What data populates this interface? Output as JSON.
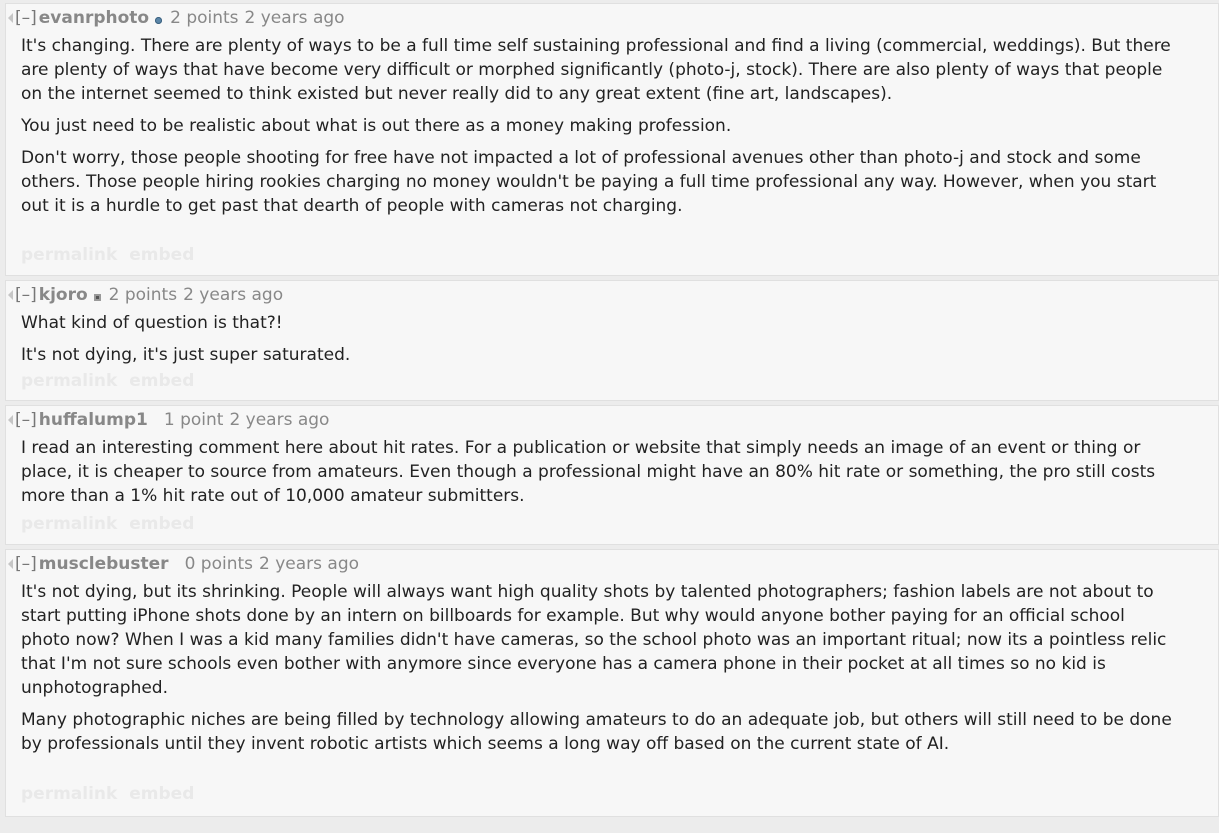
{
  "comments": [
    {
      "collapse": "[–]",
      "author": "evanrphoto",
      "flair": "globe-icon",
      "score": "2 points",
      "time": "2 years ago",
      "paragraphs": [
        "It's changing. There are plenty of ways to be a full time self sustaining professional and find a living (commercial, weddings). But there are plenty of ways that have become very difficult or morphed significantly (photo-j, stock). There are also plenty of ways that people on the internet seemed to think existed but never really did to any great extent (fine art, landscapes).",
        "You just need to be realistic about what is out there as a money making profession.",
        "Don't worry, those people shooting for free have not impacted a lot of professional avenues other than photo-j and stock and some others. Those people hiring rookies charging no money wouldn't be paying a full time professional any way. However, when you start out it is a hurdle to get past that dearth of people with cameras not charging."
      ],
      "permalink": "permalink",
      "embed": "embed"
    },
    {
      "collapse": "[–]",
      "author": "kjoro",
      "flair": "camera-icon",
      "score": "2 points",
      "time": "2 years ago",
      "paragraphs": [
        "What kind of question is that?!",
        "It's not dying, it's just super saturated."
      ],
      "permalink": "permalink",
      "embed": "embed"
    },
    {
      "collapse": "[–]",
      "author": "huffalump1",
      "flair": "",
      "score": "1 point",
      "time": "2 years ago",
      "paragraphs": [
        "I read an interesting comment here about hit rates. For a publication or website that simply needs an image of an event or thing or place, it is cheaper to source from amateurs. Even though a professional might have an 80% hit rate or something, the pro still costs more than a 1% hit rate out of 10,000 amateur submitters."
      ],
      "permalink": "permalink",
      "embed": "embed"
    },
    {
      "collapse": "[–]",
      "author": "musclebuster",
      "flair": "",
      "score": "0 points",
      "time": "2 years ago",
      "paragraphs": [
        "It's not dying, but its shrinking. People will always want high quality shots by talented photographers; fashion labels are not about to start putting iPhone shots done by an intern on billboards for example. But why would anyone bother paying for an official school photo now? When I was a kid many families didn't have cameras, so the school photo was an important ritual; now its a pointless relic that I'm not sure schools even bother with anymore since everyone has a camera phone in their pocket at all times so no kid is unphotographed.",
        "Many photographic niches are being filled by technology allowing amateurs to do an adequate job, but others will still need to be done by professionals until they invent robotic artists which seems a long way off based on the current state of AI."
      ],
      "permalink": "permalink",
      "embed": "embed"
    }
  ]
}
